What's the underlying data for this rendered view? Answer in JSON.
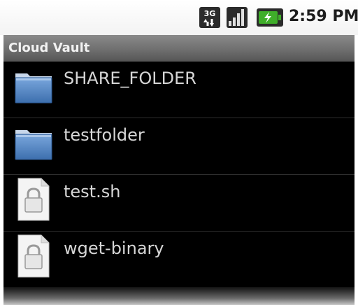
{
  "status_bar": {
    "network_icon": "3g-icon",
    "signal_icon": "signal-icon",
    "battery_icon": "battery-charging-icon",
    "time": "2:59 PM"
  },
  "app": {
    "title": "Cloud Vault"
  },
  "files": [
    {
      "name": "SHARE_FOLDER",
      "icon": "folder-icon"
    },
    {
      "name": "testfolder",
      "icon": "folder-icon"
    },
    {
      "name": "test.sh",
      "icon": "locked-file-icon"
    },
    {
      "name": "wget-binary",
      "icon": "locked-file-icon"
    }
  ],
  "colors": {
    "list_background": "#000000",
    "title_bar": "#6f6f6f",
    "folder_blue": "#4a7fc1",
    "battery_green": "#3fae2a"
  }
}
